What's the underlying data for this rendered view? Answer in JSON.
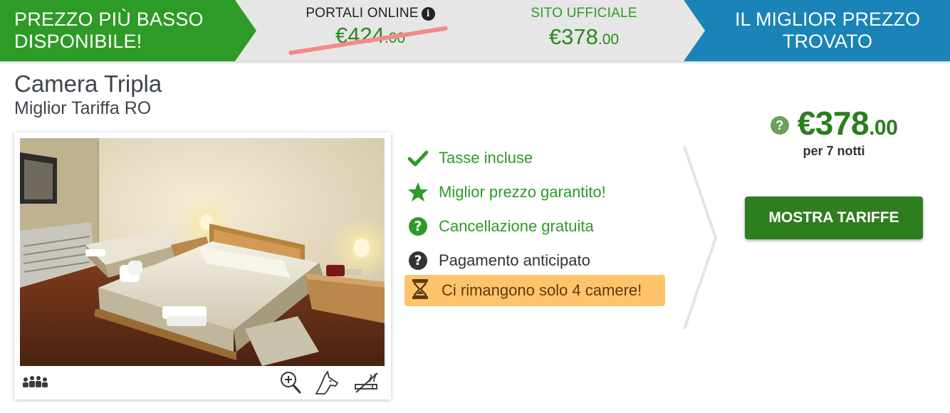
{
  "banner": {
    "left_label_line1": "PREZZO PIÙ BASSO",
    "left_label_line2": "DISPONIBILE!",
    "portali_label": "PORTALI ONLINE",
    "portali_price_main": "€424",
    "portali_price_cents": ".00",
    "sito_label": "SITO UFFICIALE",
    "sito_price_main": "€378",
    "sito_price_cents": ".00",
    "right_label_line1": "IL MIGLIOR PREZZO",
    "right_label_line2": "TROVATO",
    "colors": {
      "green": "#2e9b26",
      "blue": "#1a83b7",
      "strike": "#f48a87"
    }
  },
  "room": {
    "name": "Camera Tripla",
    "rate": "Miglior Tariffa RO"
  },
  "card_icons": [
    "guests-icon",
    "zoom-icon",
    "pets-icon",
    "no-smoking-icon"
  ],
  "features": [
    {
      "icon": "check-icon",
      "label": "Tasse incluse"
    },
    {
      "icon": "star-icon",
      "label": "Miglior prezzo garantito!"
    },
    {
      "icon": "question-icon",
      "label": "Cancellazione gratuita"
    },
    {
      "icon": "question-dark-icon",
      "label": "Pagamento anticipato"
    }
  ],
  "alert": {
    "icon": "hourglass-icon",
    "label": "Ci rimangono solo 4 camere!"
  },
  "price": {
    "main": "€378",
    "cents": ".00",
    "nights": "per 7 notti",
    "button": "MOSTRA TARIFFE"
  }
}
